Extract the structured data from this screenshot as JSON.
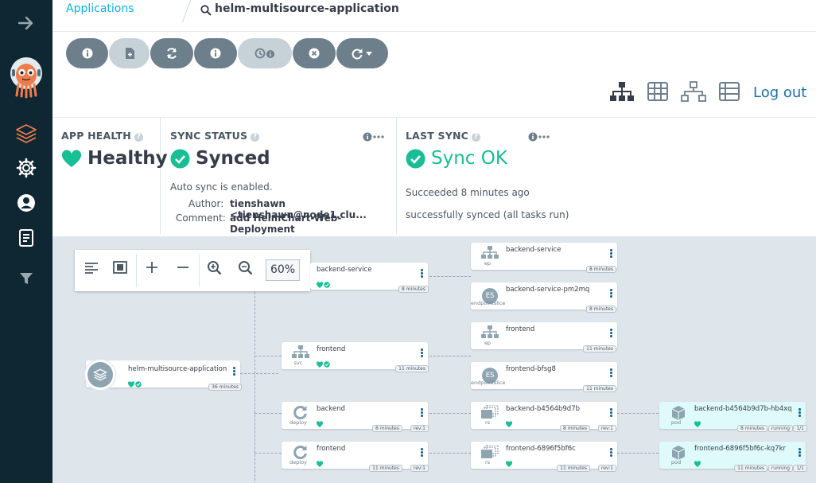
{
  "breadcrumb": {
    "root": "Applications",
    "current": "helm-multisource-application"
  },
  "header": {
    "logout": "Log out"
  },
  "app_health": {
    "title": "APP HEALTH",
    "value": "Healthy"
  },
  "sync_status": {
    "title": "SYNC STATUS",
    "value": "Synced",
    "auto_sync": "Auto sync is enabled.",
    "author_label": "Author:",
    "author": "tienshawn <tienshawn@node1.clu...",
    "comment_label": "Comment:",
    "comment": "add HelmChart-Web-Deployment"
  },
  "last_sync": {
    "title": "LAST SYNC",
    "value": "Sync OK",
    "succeeded": "Succeeded 8 minutes ago",
    "message": "successfully synced (all tasks run)"
  },
  "zoom": {
    "value": "60%"
  },
  "colors": {
    "sidebar": "#0f2733",
    "healthy": "#18be94",
    "accent": "#0dadea",
    "button": "#6d7f8b"
  },
  "nodes": {
    "app": {
      "name": "helm-multisource-application",
      "age": "36 minutes"
    },
    "backend_service": {
      "name": "backend-service",
      "age": "8 minutes"
    },
    "frontend_svc": {
      "name": "frontend",
      "kind": "svc",
      "age": "11 minutes"
    },
    "backend_deploy": {
      "name": "backend",
      "kind": "deploy",
      "age": "8 minutes",
      "rev": "rev:1"
    },
    "frontend_deploy": {
      "name": "frontend",
      "kind": "deploy",
      "age": "11 minutes",
      "rev": "rev:1"
    },
    "backend_ep": {
      "name": "backend-service",
      "kind": "ep",
      "age": "8 minutes"
    },
    "backend_es": {
      "name": "backend-service-pm2mq",
      "kind": "endpointslice",
      "icon": "ES",
      "age": "8 minutes"
    },
    "frontend_ep": {
      "name": "frontend",
      "kind": "ep",
      "age": "11 minutes"
    },
    "frontend_es": {
      "name": "frontend-bfsg8",
      "kind": "endpointslice",
      "icon": "ES",
      "age": "11 minutes"
    },
    "backend_rs": {
      "name": "backend-b4564b9d7b",
      "kind": "rs",
      "age": "8 minutes",
      "rev": "rev:1"
    },
    "frontend_rs": {
      "name": "frontend-6896f5bf6c",
      "kind": "rs",
      "age": "11 minutes",
      "rev": "rev:1"
    },
    "backend_pod": {
      "name": "backend-b4564b9d7b-hb4xq",
      "kind": "pod",
      "age": "8 minutes",
      "status": "running",
      "count": "1/1"
    },
    "frontend_pod": {
      "name": "frontend-6896f5bf6c-kq7kr",
      "kind": "pod",
      "age": "11 minutes",
      "status": "running",
      "count": "1/1"
    }
  }
}
